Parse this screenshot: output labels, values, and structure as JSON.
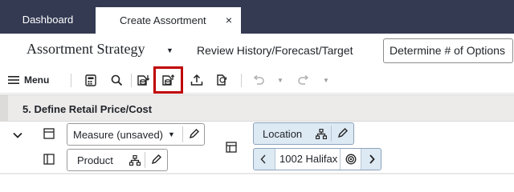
{
  "tabs": [
    {
      "label": "Dashboard",
      "active": false
    },
    {
      "label": "Create Assortment",
      "active": true,
      "close_glyph": "×"
    }
  ],
  "subheader": {
    "title": "Assortment Strategy",
    "review_link": "Review History/Forecast/Target",
    "determine_button": "Determine # of Options"
  },
  "toolbar": {
    "menu_label": "Menu",
    "icons": [
      "hamburger-icon",
      "calculator-icon",
      "search-icon",
      "db-download-icon",
      "db-upload-icon",
      "export-icon",
      "sync-icon",
      "undo-icon",
      "redo-icon"
    ],
    "highlight_color": "#c00000"
  },
  "section": {
    "title": "5. Define Retail Price/Cost"
  },
  "layout": {
    "measure_label": "Measure (unsaved)",
    "product_label": "Product",
    "location_label": "Location",
    "location_value": "1002 Halifax"
  },
  "colors": {
    "header_bg": "#343a52",
    "chip_bg": "#dde9f3",
    "band_bg": "#ecebea"
  }
}
